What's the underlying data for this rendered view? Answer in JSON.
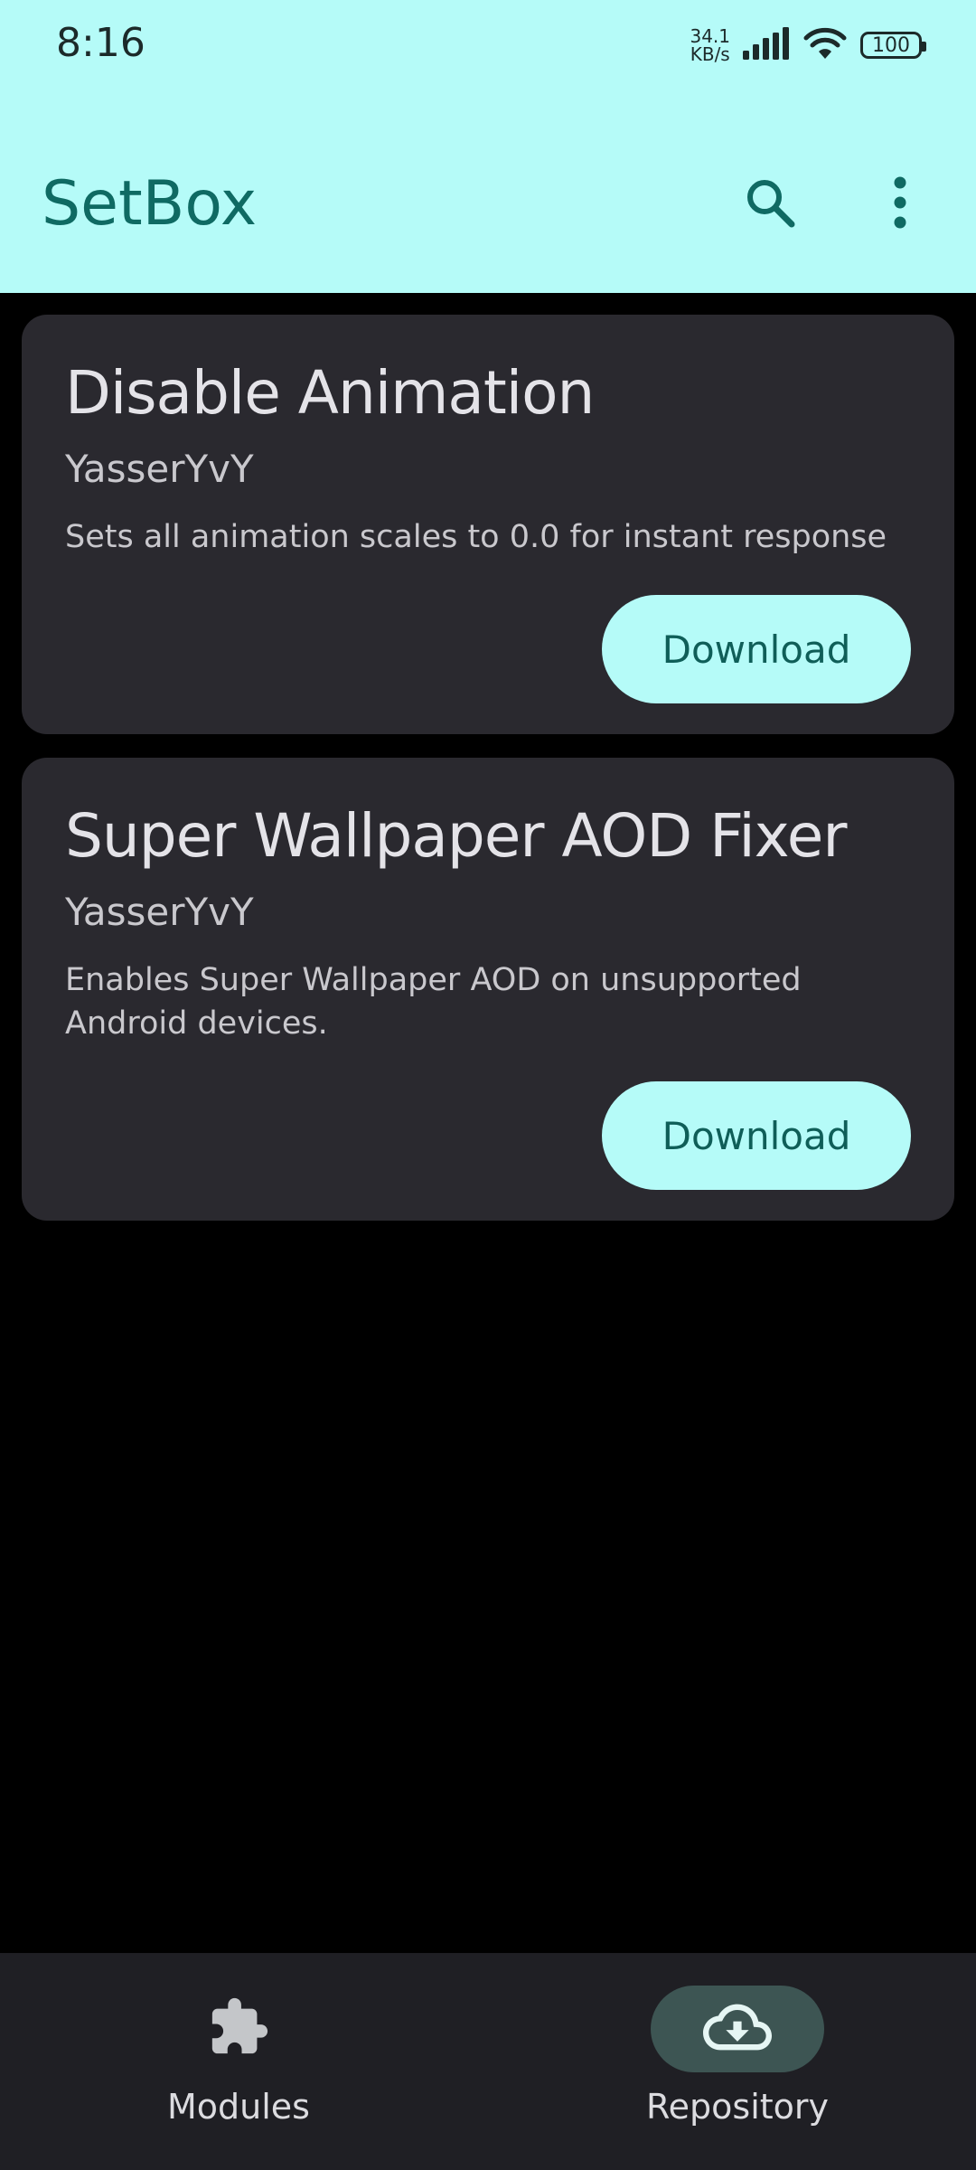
{
  "status_bar": {
    "time": "8:16",
    "net_speed_value": "34.1",
    "net_speed_unit": "KB/s",
    "battery": "100"
  },
  "app_bar": {
    "title": "SetBox",
    "search_icon": "search-icon",
    "more_icon": "more-vert-icon"
  },
  "modules": [
    {
      "title": "Disable Animation",
      "author": "YasserYvY",
      "description": "Sets all animation scales to 0.0 for instant response",
      "button_label": "Download"
    },
    {
      "title": "Super Wallpaper AOD Fixer",
      "author": "YasserYvY",
      "description": "Enables Super Wallpaper AOD on unsupported Android devices.",
      "button_label": "Download"
    }
  ],
  "bottom_nav": {
    "items": [
      {
        "label": "Modules",
        "icon": "puzzle-icon",
        "active": false
      },
      {
        "label": "Repository",
        "icon": "cloud-download-icon",
        "active": true
      }
    ]
  },
  "colors": {
    "app_bar_bg": "#B5FBF8",
    "title_color": "#0f6a63",
    "card_bg": "#2A292F",
    "nav_bg": "#1F1F24",
    "nav_active_pill": "#3D5553"
  }
}
